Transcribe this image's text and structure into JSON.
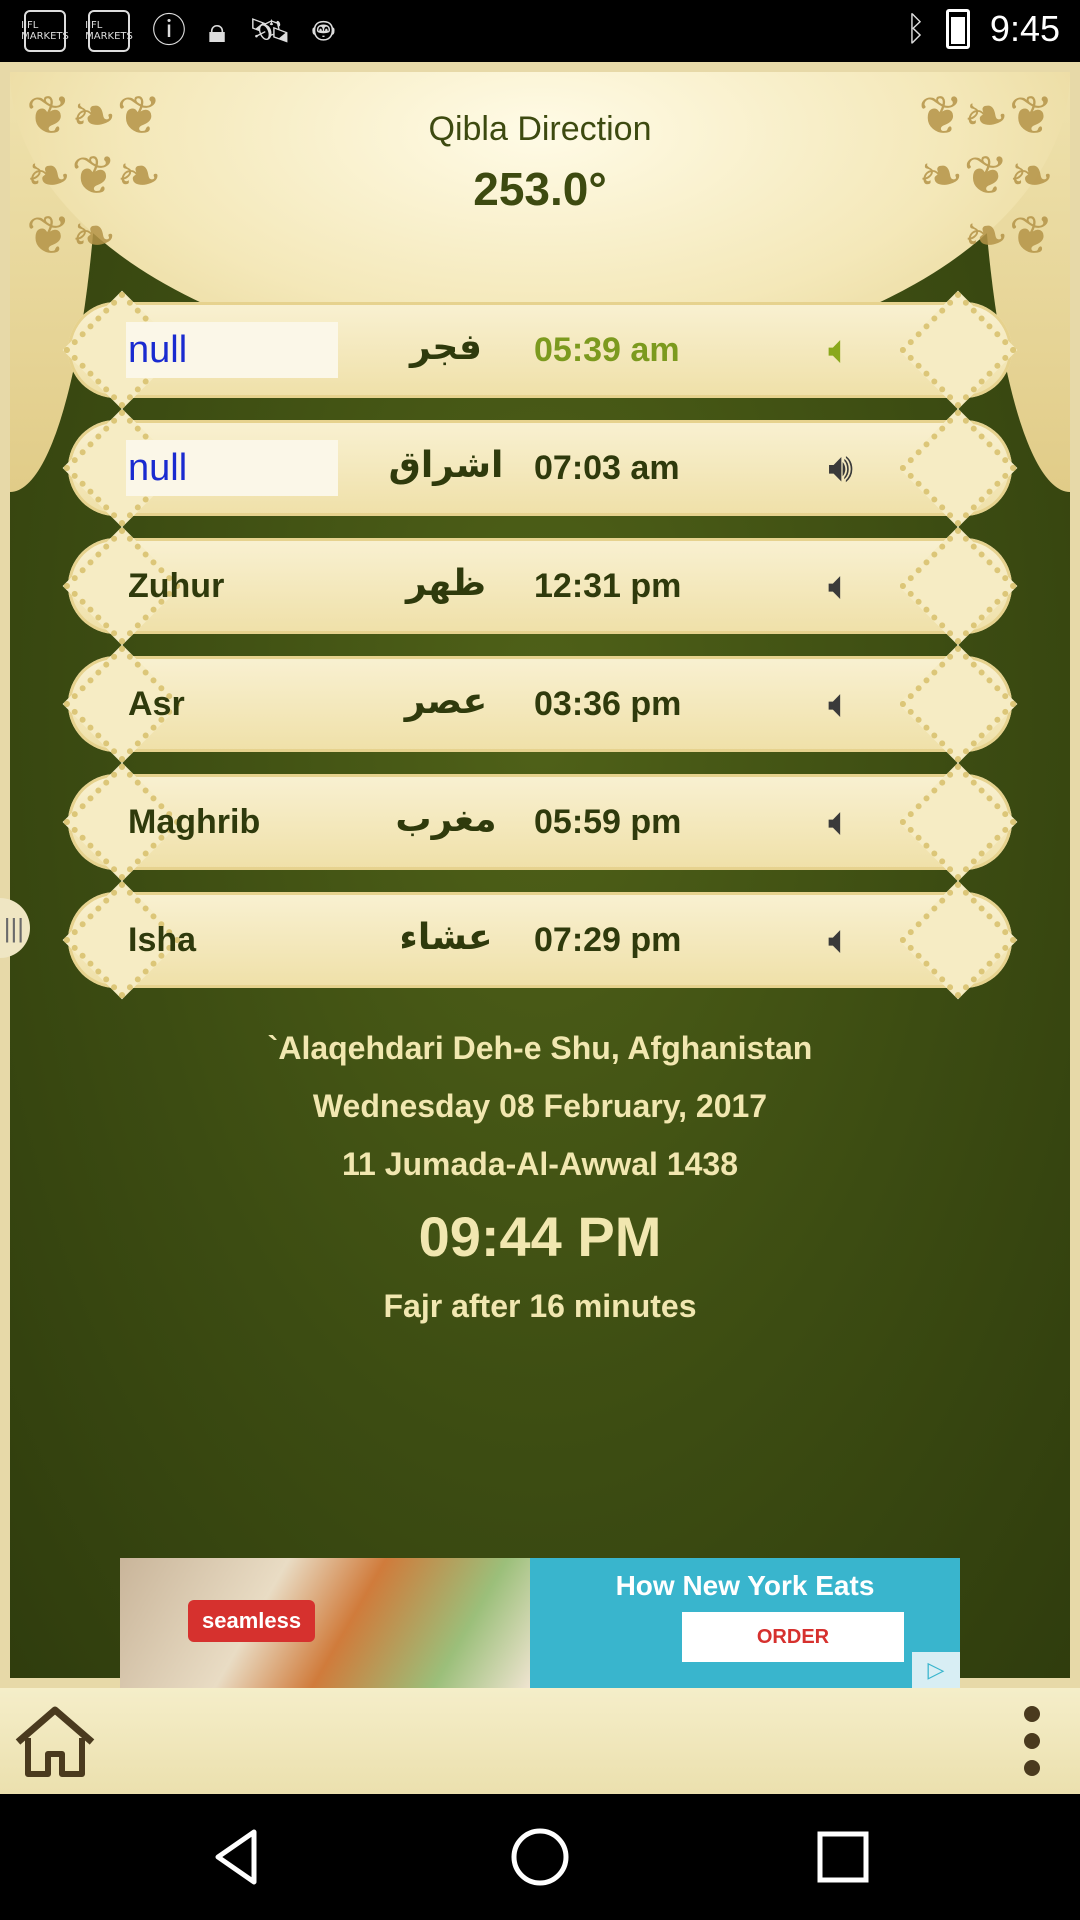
{
  "status_bar": {
    "left_icons": [
      "IIFL MARKETS",
      "IIFL MARKETS",
      "info-icon",
      "lock-icon",
      "satellite-icon",
      "android-icon"
    ],
    "left_icon_text_1": "IIFL MARKETS",
    "left_icon_text_2": "IIFL MARKETS",
    "time": "9:45",
    "right_icons": [
      "bluetooth-icon",
      "battery-icon"
    ]
  },
  "qibla": {
    "title": "Qibla Direction",
    "value": "253.0°"
  },
  "prayers": [
    {
      "name": "null",
      "arabic": "فجر",
      "time": "05:39 am",
      "speaker": "muted",
      "active": true
    },
    {
      "name": "null",
      "arabic": "اشراق",
      "time": "07:03 am",
      "speaker": "loud",
      "active": false
    },
    {
      "name": "Zuhur",
      "arabic": "ظهر",
      "time": "12:31 pm",
      "speaker": "muted",
      "active": false
    },
    {
      "name": "Asr",
      "arabic": "عصر",
      "time": "03:36 pm",
      "speaker": "muted",
      "active": false
    },
    {
      "name": "Maghrib",
      "arabic": "مغرب",
      "time": "05:59 pm",
      "speaker": "muted",
      "active": false
    },
    {
      "name": "Isha",
      "arabic": "عشاء",
      "time": "07:29 pm",
      "speaker": "muted",
      "active": false
    }
  ],
  "info": {
    "location": "`Alaqehdari Deh-e Shu, Afghanistan",
    "date": "Wednesday 08 February, 2017",
    "hijri": "11 Jumada-Al-Awwal 1438",
    "clock": "09:44 PM",
    "next_prayer": "Fajr after 16 minutes"
  },
  "ad": {
    "brand": "seamless",
    "headline": "How New York Eats",
    "cta": "ORDER"
  },
  "colors": {
    "background_green": "#3c4c12",
    "gold": "#efe0a8",
    "active_green": "#7c9a1e",
    "null_blue": "#1a2bd0"
  }
}
